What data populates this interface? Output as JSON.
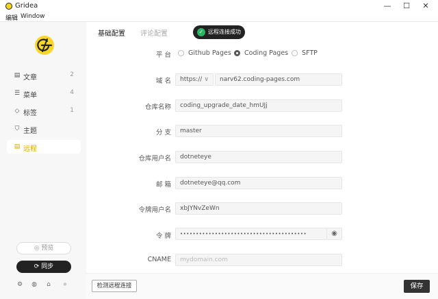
{
  "window": {
    "title": "Gridea",
    "minimize_icon": "—",
    "maximize_icon": "☐",
    "close_icon": "✕"
  },
  "menubar": [
    "编辑",
    "Window"
  ],
  "sidebar": {
    "logo_icon": "gridea-logo",
    "items": [
      {
        "label": "文章",
        "count": "2",
        "icon": "▤"
      },
      {
        "label": "菜单",
        "count": "4",
        "icon": "☰"
      },
      {
        "label": "标签",
        "count": "1",
        "icon": "◇"
      },
      {
        "label": "主题",
        "count": "",
        "icon": "⛉"
      },
      {
        "label": "远程",
        "count": "",
        "icon": "▤"
      }
    ],
    "active_item": "远程",
    "preview_label": "◎ 预览",
    "sync_label": "⟳ 同步",
    "bottom_icons": [
      "⚙",
      "◍",
      "⌂",
      "●"
    ]
  },
  "tabs": [
    {
      "label": "基础配置",
      "active": true
    },
    {
      "label": "评论配置",
      "active": false
    }
  ],
  "toast": {
    "text": "远程连接成功",
    "icon": "✓"
  },
  "form": {
    "platform": {
      "label": "平 台",
      "options": [
        "Github Pages",
        "Coding Pages",
        "SFTP"
      ],
      "selected": "Coding Pages"
    },
    "domain": {
      "label": "域 名",
      "protocol": "https://",
      "protocol_chevron": "∨",
      "value": "narv62.coding-pages.com"
    },
    "repo": {
      "label": "仓库名称",
      "value": "coding_upgrade_date_hmUJj"
    },
    "branch": {
      "label": "分 支",
      "value": "master"
    },
    "repo_user": {
      "label": "仓库用户名",
      "value": "dotneteye"
    },
    "email": {
      "label": "邮 箱",
      "value": "dotneteye@qq.com"
    },
    "token_user": {
      "label": "令牌用户名",
      "value": "xbJYNvZeWn"
    },
    "token": {
      "label": "令 牌",
      "value": "••••••••••••••••••••••••••••••••••••••••",
      "eye_icon": "◉"
    },
    "cname": {
      "label": "CNAME",
      "placeholder": "mydomain.com"
    }
  },
  "footer": {
    "check_label": "检测远程连接",
    "save_label": "保存"
  },
  "colors": {
    "accent": "#d7a700",
    "logo": "#f8d62a",
    "success": "#2bb463",
    "dark": "#222222"
  }
}
